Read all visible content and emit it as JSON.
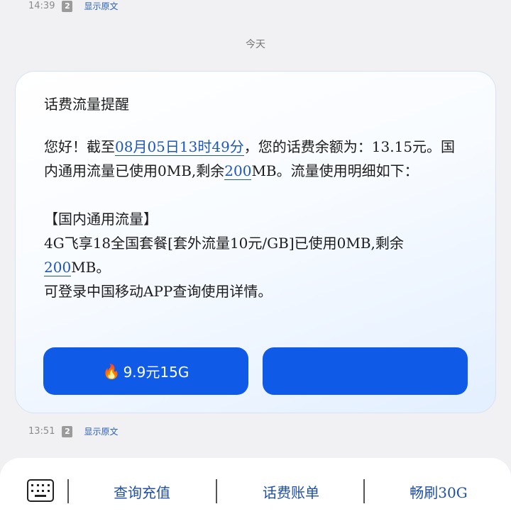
{
  "top_meta": {
    "time": "14:39",
    "sim": "2",
    "show_original": "显示原文"
  },
  "day_label": "今天",
  "message": {
    "title": "话费流量提醒",
    "p1_a": "您好！截至",
    "p1_date": "08月05日13时49分",
    "p1_b": "，您的话费余额为：13.15元。国内通用流量已使用0MB,剩余",
    "p1_remaining": "200",
    "p1_c": "MB。流量使用明细如下：",
    "section_header": "【国内通用流量】",
    "p2_a": "4G飞享18全国套餐[套外流量10元/GB]已使用0MB,剩余",
    "p2_remaining": "200",
    "p2_b": "MB。",
    "p3": "可登录中国移动APP查询使用详情。"
  },
  "buttons": {
    "left_icon": "fire-icon",
    "left_label": "9.9元15G",
    "right_label": ""
  },
  "bottom_meta": {
    "time": "13:51",
    "sim": "2",
    "show_original": "显示原文"
  },
  "bottom_bar": {
    "keyboard_icon": "keyboard-icon",
    "item1": "查询充值",
    "item2": "话费账单",
    "item3": "畅刷30G"
  },
  "colors": {
    "accent": "#0f5ae6",
    "link": "#1f57b8"
  }
}
